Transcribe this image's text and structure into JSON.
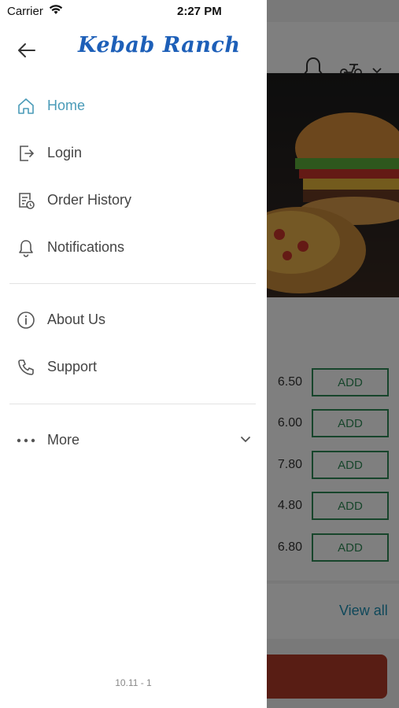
{
  "status_bar": {
    "carrier": "Carrier",
    "time": "2:27 PM"
  },
  "drawer": {
    "logo": "Kebab Ranch",
    "menu_primary": [
      {
        "label": "Home",
        "icon": "home-icon",
        "active": true
      },
      {
        "label": "Login",
        "icon": "login-icon",
        "active": false
      },
      {
        "label": "Order History",
        "icon": "order-history-icon",
        "active": false
      },
      {
        "label": "Notifications",
        "icon": "bell-icon",
        "active": false
      }
    ],
    "menu_secondary": [
      {
        "label": "About Us",
        "icon": "info-icon"
      },
      {
        "label": "Support",
        "icon": "phone-icon"
      }
    ],
    "more": {
      "label": "More",
      "icon": "more-dots-icon"
    },
    "version": "10.11 - 1"
  },
  "background": {
    "items": [
      {
        "price": "6.50",
        "add_label": "ADD"
      },
      {
        "price": "6.00",
        "add_label": "ADD"
      },
      {
        "price": "7.80",
        "add_label": "ADD"
      },
      {
        "price": "4.80",
        "add_label": "ADD"
      },
      {
        "price": "6.80",
        "add_label": "ADD"
      }
    ],
    "view_all": "View all"
  },
  "colors": {
    "accent": "#4a9bb8",
    "brand": "#1d5fb8",
    "add_green": "#2e8b57",
    "cta": "#b03a28"
  }
}
